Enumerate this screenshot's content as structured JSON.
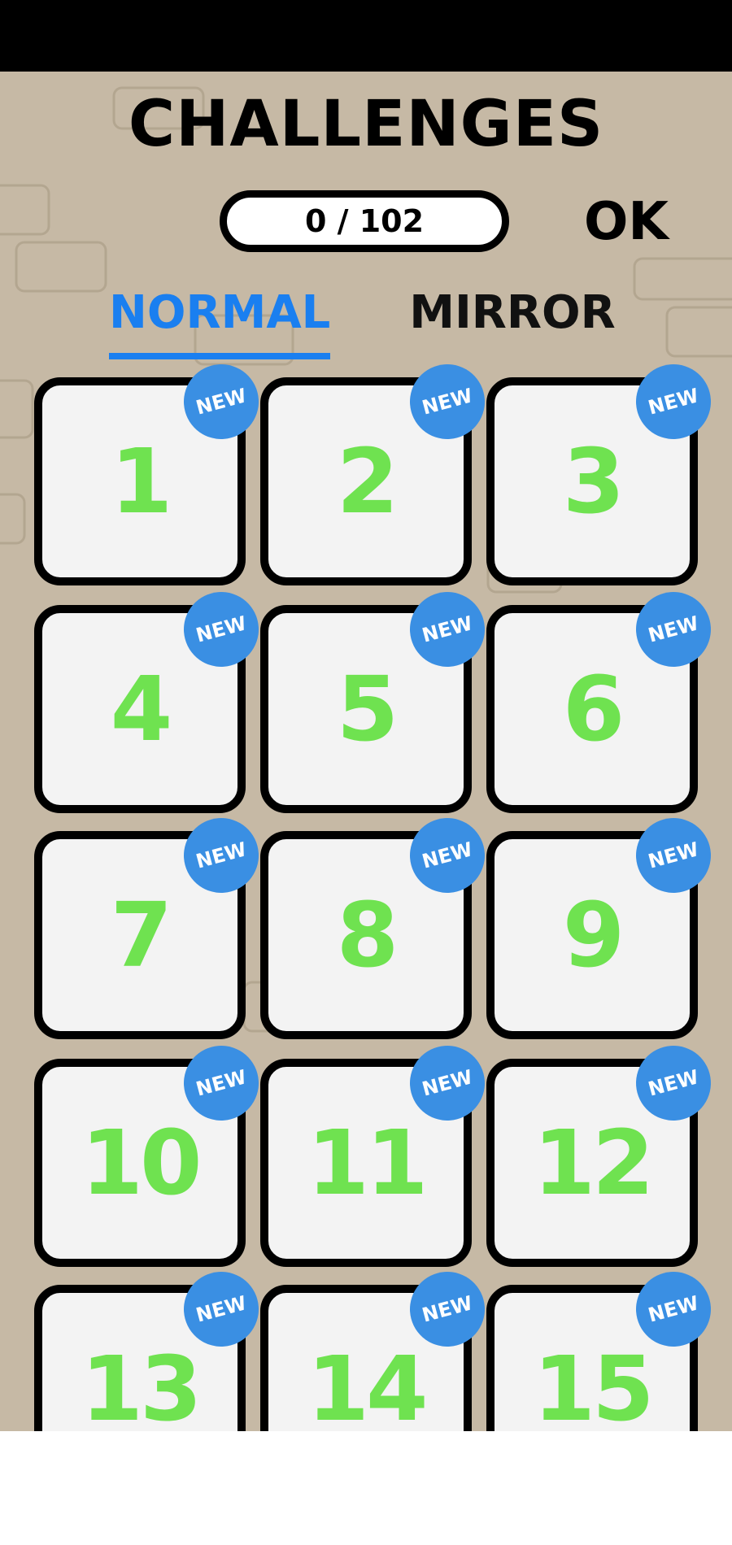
{
  "header": {
    "title": "CHALLENGES",
    "progress": "0 / 102",
    "ok_label": "OK"
  },
  "tabs": [
    {
      "label": "NORMAL",
      "active": true
    },
    {
      "label": "MIRROR",
      "active": false
    }
  ],
  "levels": [
    {
      "number": "1",
      "badge": "NEW"
    },
    {
      "number": "2",
      "badge": "NEW"
    },
    {
      "number": "3",
      "badge": "NEW"
    },
    {
      "number": "4",
      "badge": "NEW"
    },
    {
      "number": "5",
      "badge": "NEW"
    },
    {
      "number": "6",
      "badge": "NEW"
    },
    {
      "number": "7",
      "badge": "NEW"
    },
    {
      "number": "8",
      "badge": "NEW"
    },
    {
      "number": "9",
      "badge": "NEW"
    },
    {
      "number": "10",
      "badge": "NEW"
    },
    {
      "number": "11",
      "badge": "NEW"
    },
    {
      "number": "12",
      "badge": "NEW"
    },
    {
      "number": "13",
      "badge": "NEW"
    },
    {
      "number": "14",
      "badge": "NEW"
    },
    {
      "number": "15",
      "badge": "NEW"
    }
  ],
  "colors": {
    "background": "#c6b9a5",
    "level_number": "#6fe250",
    "badge": "#3a8fe3",
    "active_tab": "#1a7ff0",
    "tile": "#f3f3f3"
  }
}
